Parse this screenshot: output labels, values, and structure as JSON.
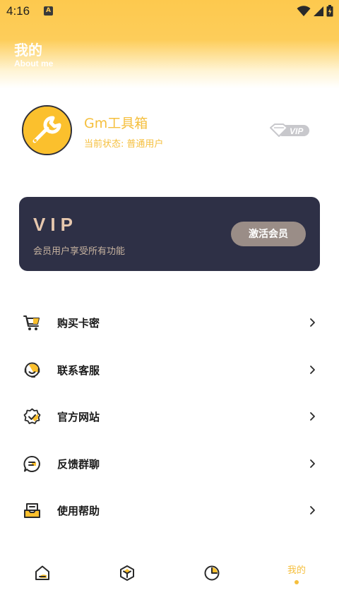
{
  "status_bar": {
    "time": "4:16",
    "app_icon_letter": "A"
  },
  "header": {
    "title": "我的",
    "subtitle": "About me"
  },
  "profile": {
    "app_name": "Gm工具箱",
    "status_label": "当前状态:",
    "status_value": "普通用户",
    "badge": "VIP"
  },
  "vip_card": {
    "title": "VIP",
    "description": "会员用户享受所有功能",
    "button_label": "激活会员"
  },
  "menu": {
    "items": [
      {
        "label": "购买卡密",
        "icon": "cart-icon"
      },
      {
        "label": "联系客服",
        "icon": "customer-service-icon"
      },
      {
        "label": "官方网站",
        "icon": "verified-badge-icon"
      },
      {
        "label": "反馈群聊",
        "icon": "chat-bubble-icon"
      },
      {
        "label": "使用帮助",
        "icon": "help-inbox-icon"
      }
    ]
  },
  "bottom_nav": {
    "items": [
      {
        "label": "首页",
        "icon": "home-icon",
        "active": false
      },
      {
        "label": "工具",
        "icon": "cube-icon",
        "active": false
      },
      {
        "label": "统计",
        "icon": "pie-chart-icon",
        "active": false
      },
      {
        "label": "我的",
        "icon": "",
        "active": true
      }
    ]
  },
  "colors": {
    "accent": "#f5bf3d",
    "header": "#fdc94e",
    "card": "#2e3046",
    "button": "#9a8d87"
  }
}
